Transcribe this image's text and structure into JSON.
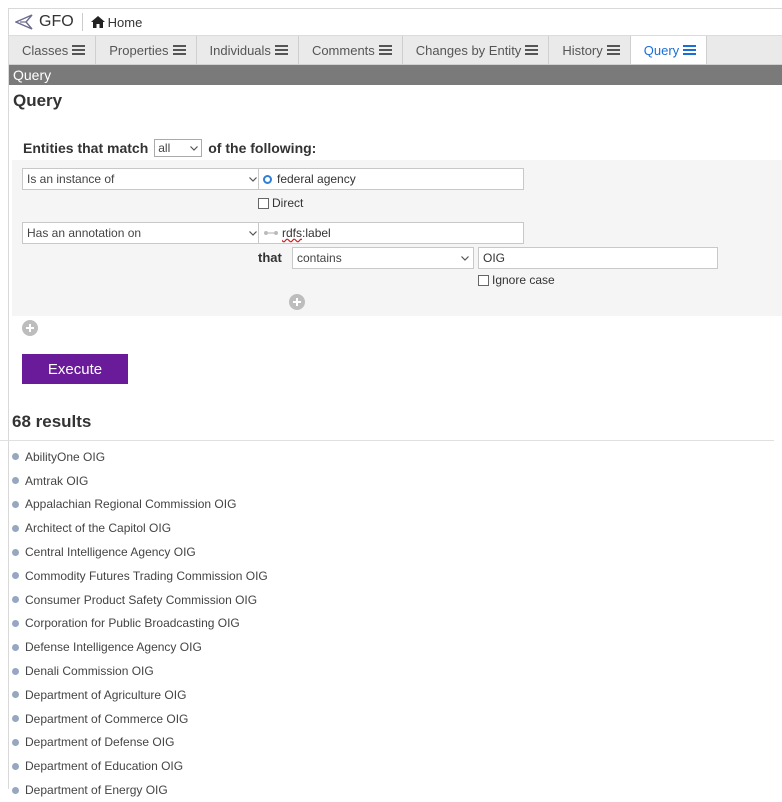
{
  "app": {
    "title": "GFO",
    "home_label": "Home"
  },
  "tabs": [
    {
      "label": "Classes",
      "active": false
    },
    {
      "label": "Properties",
      "active": false
    },
    {
      "label": "Individuals",
      "active": false
    },
    {
      "label": "Comments",
      "active": false
    },
    {
      "label": "Changes by Entity",
      "active": false
    },
    {
      "label": "History",
      "active": false
    },
    {
      "label": "Query",
      "active": true
    }
  ],
  "section_bar": "Query",
  "heading": "Query",
  "query": {
    "match_prefix": "Entities that match",
    "match_value": "all",
    "match_suffix": "of the following:",
    "criteria": [
      {
        "type": "Is an instance of",
        "value": "federal agency",
        "checkbox_label": "Direct"
      },
      {
        "type": "Has an annotation on",
        "prop_prefix": "rdfs",
        "prop_suffix": ":label",
        "that_label": "that",
        "operator": "contains",
        "text": "OIG",
        "checkbox_label": "Ignore case"
      }
    ],
    "execute_label": "Execute"
  },
  "results": {
    "count_label": "68 results",
    "items": [
      "AbilityOne OIG",
      "Amtrak OIG",
      "Appalachian Regional Commission OIG",
      "Architect of the Capitol OIG",
      "Central Intelligence Agency OIG",
      "Commodity Futures Trading Commission OIG",
      "Consumer Product Safety Commission OIG",
      "Corporation for Public Broadcasting OIG",
      "Defense Intelligence Agency OIG",
      "Denali Commission OIG",
      "Department of Agriculture OIG",
      "Department of Commerce OIG",
      "Department of Defense OIG",
      "Department of Education OIG",
      "Department of Energy OIG"
    ]
  },
  "colors": {
    "accent": "#6a1b9a",
    "active_tab": "#1a6fd6",
    "section_bar": "#7a7a7a",
    "bullet": "#96a7c2"
  }
}
